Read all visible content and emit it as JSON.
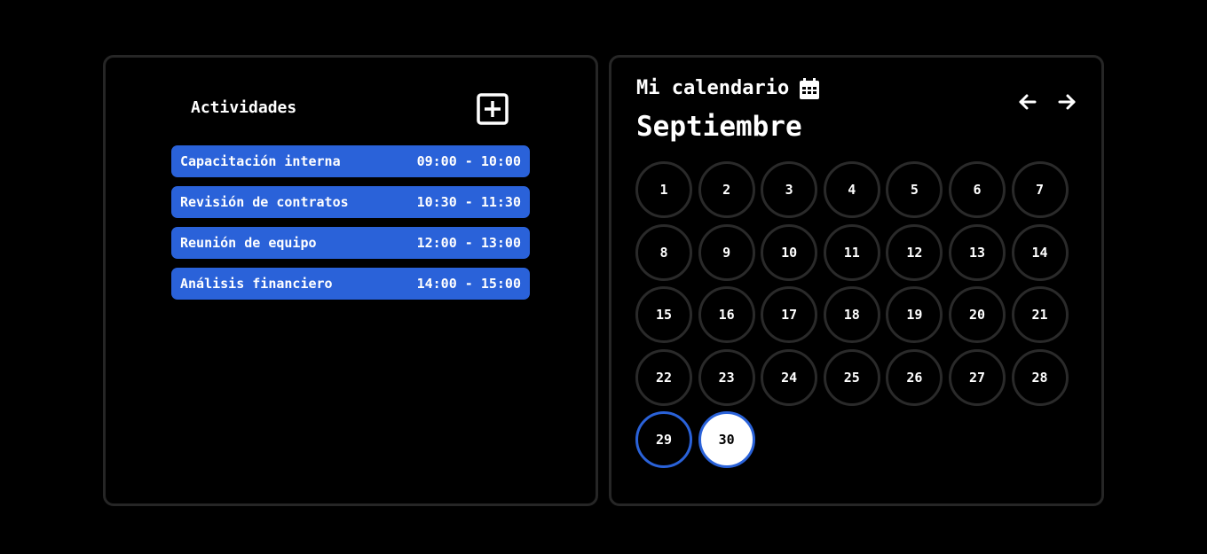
{
  "activities": {
    "title": "Actividades",
    "add_icon": "plus-square-icon",
    "items": [
      {
        "name": "Capacitación interna",
        "time": "09:00 - 10:00"
      },
      {
        "name": "Revisión de contratos",
        "time": "10:30 - 11:30"
      },
      {
        "name": "Reunión de equipo",
        "time": "12:00 - 13:00"
      },
      {
        "name": "Análisis financiero",
        "time": "14:00 - 15:00"
      }
    ]
  },
  "calendar": {
    "title": "Mi calendario",
    "title_icon": "calendar-icon",
    "month": "Septiembre",
    "prev_icon": "arrow-left-icon",
    "next_icon": "arrow-right-icon",
    "days": [
      "1",
      "2",
      "3",
      "4",
      "5",
      "6",
      "7",
      "8",
      "9",
      "10",
      "11",
      "12",
      "13",
      "14",
      "15",
      "16",
      "17",
      "18",
      "19",
      "20",
      "21",
      "22",
      "23",
      "24",
      "25",
      "26",
      "27",
      "28",
      "29",
      "30"
    ],
    "highlighted_day": "29",
    "selected_day": "30"
  },
  "colors": {
    "accent": "#2a62d9",
    "background": "#000000",
    "border": "#262626",
    "text": "#ffffff"
  }
}
